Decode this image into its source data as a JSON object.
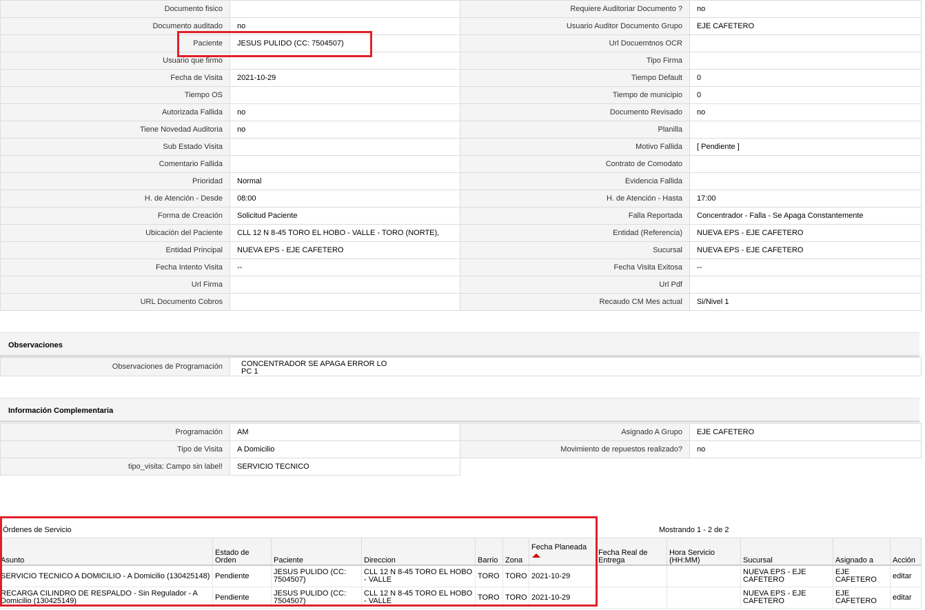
{
  "details": [
    {
      "l1": "Documento fisico",
      "v1": "",
      "l2": "Requiere Auditoriar Documento ?",
      "v2": "no"
    },
    {
      "l1": "Documento auditado",
      "v1": "no",
      "l2": "Usuario Auditor Documento Grupo",
      "v2": "EJE CAFETERO"
    },
    {
      "l1": "Paciente",
      "v1": "JESUS PULIDO (CC: 7504507)",
      "l2": "Url Docuemtnos OCR",
      "v2": ""
    },
    {
      "l1": "Usuario que firmo",
      "v1": "",
      "l2": "Tipo Firma",
      "v2": ""
    },
    {
      "l1": "Fecha de Visita",
      "v1": "2021-10-29",
      "l2": "Tiempo Default",
      "v2": "0"
    },
    {
      "l1": "Tiempo OS",
      "v1": "",
      "l2": "Tiempo de municipio",
      "v2": "0"
    },
    {
      "l1": "Autorizada Fallida",
      "v1": "no",
      "l2": "Documento Revisado",
      "v2": "no"
    },
    {
      "l1": "Tiene Novedad Auditoria",
      "v1": "no",
      "l2": "Planilla",
      "v2": ""
    },
    {
      "l1": "Sub Estado Visita",
      "v1": "",
      "l2": "Motivo Fallida",
      "v2": "[ Pendiente ]"
    },
    {
      "l1": "Comentario Fallida",
      "v1": "",
      "l2": "Contrato de Comodato",
      "v2": ""
    },
    {
      "l1": "Prioridad",
      "v1": "Normal",
      "l2": "Evidencia Fallida",
      "v2": ""
    },
    {
      "l1": "H. de Atención - Desde",
      "v1": "08:00",
      "l2": "H. de Atención - Hasta",
      "v2": "17:00"
    },
    {
      "l1": "Forma de Creación",
      "v1": "Solicitud Paciente",
      "l2": "Falla Reportada",
      "v2": "Concentrador - Falla - Se Apaga Constantemente"
    },
    {
      "l1": "Ubicación del Paciente",
      "v1": "CLL 12 N 8-45 TORO EL HOBO - VALLE - TORO (NORTE),",
      "l2": "Entidad (Referencia)",
      "v2": "NUEVA EPS - EJE CAFETERO"
    },
    {
      "l1": "Entidad Principal",
      "v1": "NUEVA EPS - EJE CAFETERO",
      "l2": "Sucursal",
      "v2": "NUEVA EPS - EJE CAFETERO"
    },
    {
      "l1": "Fecha Intento Visita",
      "v1": "--",
      "l2": "Fecha Visita Exitosa",
      "v2": "--"
    },
    {
      "l1": "Url Firma",
      "v1": "",
      "l2": "Url Pdf",
      "v2": ""
    },
    {
      "l1": "URL Documento Cobros",
      "v1": "",
      "l2": "Recaudo CM Mes actual",
      "v2": "Si/Nivel 1"
    }
  ],
  "observaciones": {
    "title": "Observaciones",
    "label": "Observaciones de Programación",
    "line1": "CONCENTRADOR SE APAGA ERROR LO",
    "line2": "PC 1"
  },
  "info": {
    "title": "Información Complementaria",
    "rows": [
      {
        "l1": "Programación",
        "v1": "AM",
        "l2": "Asignado A Grupo",
        "v2": "EJE CAFETERO"
      },
      {
        "l1": "Tipo de Visita",
        "v1": "A Domicilio",
        "l2": "Movimiento de repuestos realizado?",
        "v2": "no"
      }
    ],
    "last": {
      "l1": "tipo_visita: Campo sin label!",
      "v1": "SERVICIO TECNICO"
    }
  },
  "orders": {
    "title": "Órdenes de Servicio",
    "showing": "Mostrando 1 - 2 de 2",
    "headers": {
      "asunto": "Asunto",
      "estado": "Estado de Orden",
      "paciente": "Paciente",
      "direccion": "Direccion",
      "barrio": "Barrio",
      "zona": "Zona",
      "fecha_planeada": "Fecha Planeada",
      "fecha_real": "Fecha Real de Entrega",
      "hora": "Hora Servicio (HH:MM)",
      "sucursal": "Sucursal",
      "asignado": "Asignado a",
      "accion": "Acción"
    },
    "rows": [
      {
        "asunto": "SERVICIO TECNICO A DOMICILIO - A Domicilio (130425148)",
        "estado": "Pendiente",
        "paciente": "JESUS PULIDO (CC: 7504507)",
        "direccion": "CLL 12 N 8-45 TORO EL HOBO - VALLE",
        "barrio": "TORO",
        "zona": "TORO",
        "fecha_planeada": "2021-10-29",
        "fecha_real": "",
        "hora": "",
        "sucursal": "NUEVA EPS - EJE CAFETERO",
        "asignado": "EJE CAFETERO",
        "accion": "editar"
      },
      {
        "asunto": "RECARGA CILINDRO DE RESPALDO - Sin Regulador - A Domicilio (130425149)",
        "estado": "Pendiente",
        "paciente": "JESUS PULIDO (CC: 7504507)",
        "direccion": "CLL 12 N 8-45 TORO EL HOBO - VALLE",
        "barrio": "TORO",
        "zona": "TORO",
        "fecha_planeada": "2021-10-29",
        "fecha_real": "",
        "hora": "",
        "sucursal": "NUEVA EPS - EJE CAFETERO",
        "asignado": "EJE CAFETERO",
        "accion": "editar"
      }
    ]
  },
  "colors": {
    "highlight": "#e0202a",
    "sort_arrow": "#cc0000",
    "label_bg": "#f4f4f4"
  }
}
